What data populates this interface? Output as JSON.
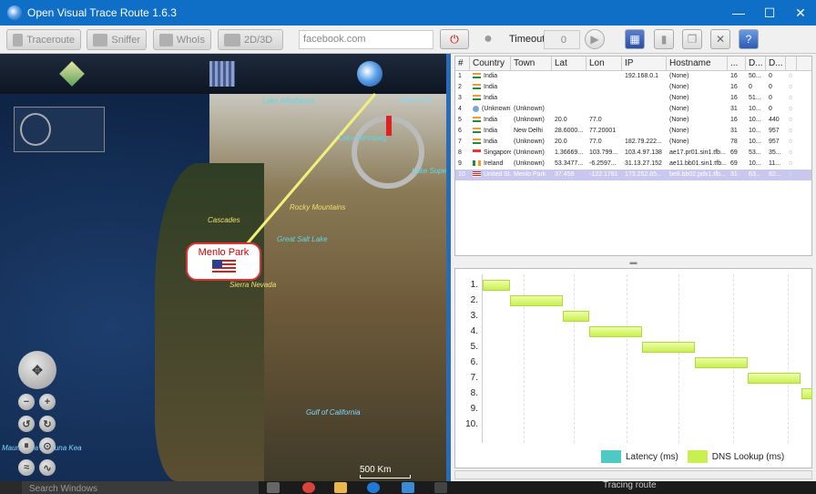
{
  "window": {
    "title": "Open Visual Trace Route 1.6.3",
    "minimize": "—",
    "maximize": "☐",
    "close": "✕"
  },
  "toolbar": {
    "traceroute": "Traceroute",
    "sniffer": "Sniffer",
    "whois": "WhoIs",
    "mode": "2D/3D",
    "url_value": "facebook.com",
    "timeout_label": "Timeout",
    "timeout_value": "0"
  },
  "map": {
    "labels": {
      "lake_athabasca": "Lake Athabasca",
      "lake_winnipeg": "Lake Winnipeg",
      "lake_superior": "Lake Supe",
      "gulf": "Gulf of Ca",
      "cascades": "Cascades",
      "rocky": "Rocky Mountains",
      "salt_lake": "Great Salt Lake",
      "sierra": "Sierra Nevada",
      "gulf_california": "Gulf of California",
      "mauna": "Mauna Loa / Mauna Kea"
    },
    "callout_name": "Menlo Park",
    "scale": "500 Km"
  },
  "table": {
    "columns": [
      "#",
      "Country",
      "Town",
      "Lat",
      "Lon",
      "IP",
      "Hostname",
      "...",
      "D...",
      "D...",
      ""
    ],
    "rows": [
      {
        "n": "1",
        "flag": "in",
        "country": "India",
        "town": "",
        "lat": "",
        "lon": "",
        "ip": "192.168.0.1",
        "host": "(None)",
        "a": "16",
        "b": "50...",
        "c": "0"
      },
      {
        "n": "2",
        "flag": "in",
        "country": "India",
        "town": "",
        "lat": "",
        "lon": "",
        "ip": "",
        "host": "(None)",
        "a": "16",
        "b": "0",
        "c": "0"
      },
      {
        "n": "3",
        "flag": "in",
        "country": "India",
        "town": "",
        "lat": "",
        "lon": "",
        "ip": "",
        "host": "(None)",
        "a": "16",
        "b": "51...",
        "c": "0"
      },
      {
        "n": "4",
        "flag": "un",
        "country": "(Unknown)",
        "town": "(Unknown)",
        "lat": "",
        "lon": "",
        "ip": "",
        "host": "(None)",
        "a": "31",
        "b": "10...",
        "c": "0"
      },
      {
        "n": "5",
        "flag": "in",
        "country": "India",
        "town": "(Unknown)",
        "lat": "20.0",
        "lon": "77.0",
        "ip": "",
        "host": "(None)",
        "a": "16",
        "b": "10...",
        "c": "440"
      },
      {
        "n": "6",
        "flag": "in",
        "country": "India",
        "town": "New Delhi",
        "lat": "28.6000...",
        "lon": "77.20001",
        "ip": "",
        "host": "(None)",
        "a": "31",
        "b": "10...",
        "c": "957"
      },
      {
        "n": "7",
        "flag": "in",
        "country": "India",
        "town": "(Unknown)",
        "lat": "20.0",
        "lon": "77.0",
        "ip": "182.79.222...",
        "host": "(None)",
        "a": "78",
        "b": "10...",
        "c": "957"
      },
      {
        "n": "8",
        "flag": "sg",
        "country": "Singapore",
        "town": "(Unknown)",
        "lat": "1.36669...",
        "lon": "103.799...",
        "ip": "103.4.97.138",
        "host": "ae17.pr01.sin1.tfb...",
        "a": "69",
        "b": "53...",
        "c": "35..."
      },
      {
        "n": "9",
        "flag": "ie",
        "country": "Ireland",
        "town": "(Unknown)",
        "lat": "53.3477...",
        "lon": "-6.2597...",
        "ip": "31.13.27.152",
        "host": "ae11.bb01.sin1.tfb...",
        "a": "69",
        "b": "10...",
        "c": "11..."
      },
      {
        "n": "10",
        "flag": "us",
        "country": "United St...",
        "town": "Menlo Park",
        "lat": "37.459",
        "lon": "-122.1781",
        "ip": "173.252.65...",
        "host": "be8.bb02.pdx1.tfb...",
        "a": "31",
        "b": "63...",
        "c": "82..."
      }
    ]
  },
  "gantt": {
    "rows": [
      "1.",
      "2.",
      "3.",
      "4.",
      "5.",
      "6.",
      "7.",
      "8.",
      "9.",
      "10."
    ],
    "legend_latency": "Latency (ms)",
    "legend_dns": "DNS Lookup (ms)",
    "colors": {
      "latency": "#4fc9c3",
      "dns": "#c9ef50"
    }
  },
  "status": "Tracing route",
  "taskbar": {
    "search": "Search Windows"
  }
}
